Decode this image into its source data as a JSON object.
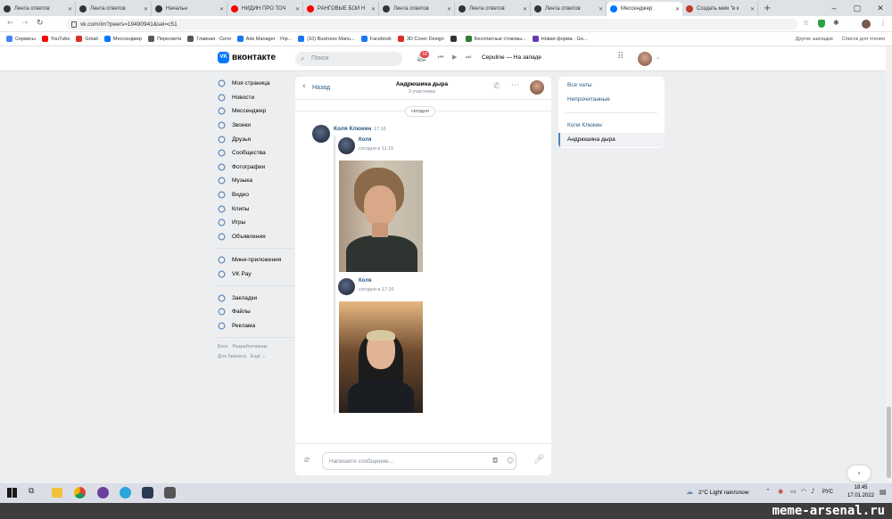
{
  "browser": {
    "tabs": [
      {
        "label": "Лента ответов",
        "color": "#333333"
      },
      {
        "label": "Лента ответов",
        "color": "#333333"
      },
      {
        "label": "Начальн",
        "color": "#333333"
      },
      {
        "label": "НИДИН ПРО ТОЧ",
        "color": "#ff0000"
      },
      {
        "label": "РАНГОВЫЕ БОИ Н",
        "color": "#ff0000"
      },
      {
        "label": "Лента ответов",
        "color": "#333333"
      },
      {
        "label": "Лента ответов",
        "color": "#333333"
      },
      {
        "label": "Лента ответов",
        "color": "#333333"
      },
      {
        "label": "Мессенджер",
        "color": "#0077ff"
      },
      {
        "label": "Создать мем \"в к",
        "color": "#c0392b"
      }
    ],
    "active_tab_index": 8,
    "url": "vk.com/im?peers=19490941&sel=c51",
    "bookmarks": [
      {
        "label": "Сервисы",
        "color": "#4285f4"
      },
      {
        "label": "YouTube",
        "color": "#ff0000"
      },
      {
        "label": "Gmail",
        "color": "#d93025"
      },
      {
        "label": "Мессенджер",
        "color": "#0077ff"
      },
      {
        "label": "Пересвети",
        "color": "#5a5a5a"
      },
      {
        "label": "Главная · Сити",
        "color": "#555555"
      },
      {
        "label": "Ads Manager · Упр...",
        "color": "#1877f2"
      },
      {
        "label": "(10) Business Manu...",
        "color": "#1877f2"
      },
      {
        "label": "Facebook",
        "color": "#1877f2"
      },
      {
        "label": "3D Cover Design",
        "color": "#d93025"
      },
      {
        "label": "",
        "color": "#333333"
      },
      {
        "label": "Бесплатные стоковы...",
        "color": "#2e7d32"
      },
      {
        "label": "Новая форма · Go...",
        "color": "#673ab7"
      }
    ],
    "bookmarks_right": [
      "Другие закладки",
      "Список для чтения"
    ]
  },
  "vk": {
    "logo": "вконтакте",
    "search_placeholder": "Поиск",
    "notif_count": "18",
    "player_text": "Cepuline — На западе",
    "sidebar": [
      {
        "label": "Моя страница",
        "icon": "profile-icon"
      },
      {
        "label": "Новости",
        "icon": "news-icon"
      },
      {
        "label": "Мессенджер",
        "icon": "messenger-icon"
      },
      {
        "label": "Звонки",
        "icon": "calls-icon"
      },
      {
        "label": "Друзья",
        "icon": "friends-icon"
      },
      {
        "label": "Сообщества",
        "icon": "communities-icon"
      },
      {
        "label": "Фотографии",
        "icon": "photos-icon"
      },
      {
        "label": "Музыка",
        "icon": "music-icon"
      },
      {
        "label": "Видео",
        "icon": "video-icon"
      },
      {
        "label": "Клипы",
        "icon": "clips-icon"
      },
      {
        "label": "Игры",
        "icon": "games-icon"
      },
      {
        "label": "Объявления",
        "icon": "ads-icon"
      }
    ],
    "sidebar2": [
      {
        "label": "Мини-приложения",
        "icon": "apps-icon"
      },
      {
        "label": "VK Pay",
        "icon": "vkpay-icon"
      }
    ],
    "sidebar3": [
      {
        "label": "Закладки",
        "icon": "bookmarks-icon"
      },
      {
        "label": "Файлы",
        "icon": "files-icon"
      },
      {
        "label": "Реклама",
        "icon": "advertising-icon"
      }
    ],
    "footer": [
      "Блог",
      "Разработчикам",
      "Для бизнеса",
      "Ещё ⌄"
    ],
    "chat": {
      "back": "Назад",
      "title": "Андрюшина дыра",
      "subtitle": "3 участника",
      "date_chip": "сегодня",
      "sender": "Коля Клюкин",
      "sender_time": "17:16",
      "fwd1_name": "Коля",
      "fwd1_time": "сегодня в 11:15",
      "fwd2_name": "Коля",
      "fwd2_time": "сегодня в 17:16",
      "input_placeholder": "Напишите сообщение..."
    },
    "right_panel": {
      "all": "Все чаты",
      "unread": "Непрочитанные",
      "person": "Коля Клюкин",
      "active": "Андрюшина дыра"
    }
  },
  "taskbar": {
    "weather": "2°C  Light rain/snow",
    "lang": "РУС",
    "time": "18:45",
    "date": "17.01.2022"
  },
  "watermark": "meme-arsenal.ru"
}
